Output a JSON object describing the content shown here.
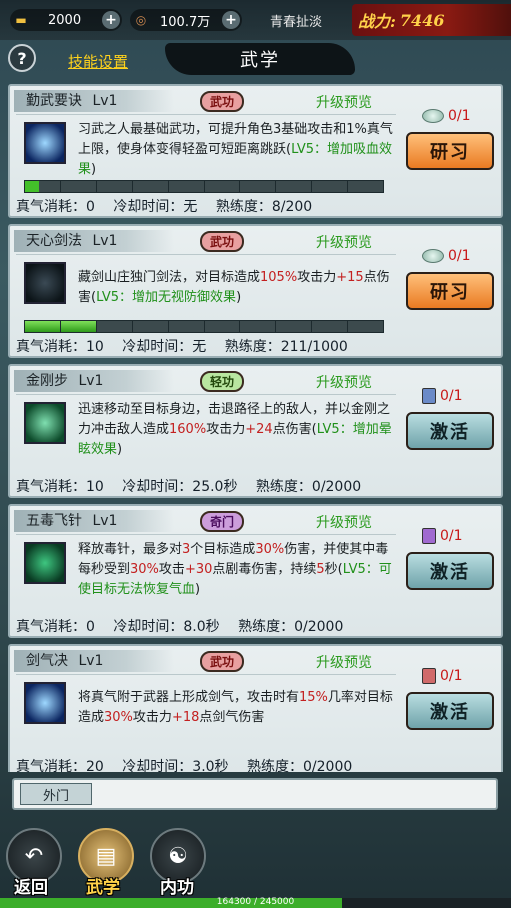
{
  "header": {
    "ingot": "2000",
    "coins": "100.7万",
    "server": "青春扯淡",
    "power_label": "战力:",
    "power_value": "7446",
    "help": "?",
    "skill_settings": "技能设置",
    "title": "武学"
  },
  "skills": [
    {
      "name": "勤武要诀",
      "level": "Lv1",
      "tag": "武功",
      "upgrade": "升级预览",
      "desc_parts": [
        "习武之人最基础武功，可提升角色3基础攻击和1%真气上限，使身体变得轻盈可短距离跳跃(",
        "LV5：增加吸血效果",
        ")"
      ],
      "cost": "0/1",
      "button": "研习",
      "progress": 0.04,
      "stats": {
        "qi": "真气消耗：0",
        "cd": "冷却时间：无",
        "prof": "熟练度：8/200"
      }
    },
    {
      "name": "天心剑法",
      "level": "Lv1",
      "tag": "武功",
      "upgrade": "升级预览",
      "desc_parts": [
        "藏剑山庄独门剑法，对目标造成",
        "105%",
        "攻击力",
        "+15",
        "点伤害(",
        "LV5：增加无视防御效果",
        ")"
      ],
      "cost": "0/1",
      "button": "研习",
      "progress": 0.21,
      "stats": {
        "qi": "真气消耗：10",
        "cd": "冷却时间：无",
        "prof": "熟练度：211/1000"
      }
    },
    {
      "name": "金刚步",
      "level": "Lv1",
      "tag": "轻功",
      "upgrade": "升级预览",
      "desc_parts": [
        "迅速移动至目标身边，击退路径上的敌人，并以金刚之力冲击敌人造成",
        "160%",
        "攻击力",
        "+24",
        "点伤害(",
        "LV5：增加晕眩效果",
        ")"
      ],
      "cost": "0/1",
      "button": "激活",
      "stats": {
        "qi": "真气消耗：10",
        "cd": "冷却时间：25.0秒",
        "prof": "熟练度：0/2000"
      }
    },
    {
      "name": "五毒飞针",
      "level": "Lv1",
      "tag": "奇门",
      "upgrade": "升级预览",
      "desc_parts": [
        "释放毒针，最多对",
        "3",
        "个目标造成",
        "30%",
        "伤害，并使其中毒每秒受到",
        "30%",
        "攻击",
        "+30",
        "点剧毒伤害，持续",
        "5",
        "秒(",
        "LV5：可使目标无法恢复气血",
        ")"
      ],
      "cost": "0/1",
      "button": "激活",
      "stats": {
        "qi": "真气消耗：0",
        "cd": "冷却时间：8.0秒",
        "prof": "熟练度：0/2000"
      }
    },
    {
      "name": "剑气决",
      "level": "Lv1",
      "tag": "武功",
      "upgrade": "升级预览",
      "desc_parts": [
        "将真气附于武器上形成剑气，攻击时有",
        "15%",
        "几率对目标造成",
        "30%",
        "攻击力",
        "+18",
        "点剑气伤害"
      ],
      "cost": "0/1",
      "button": "激活",
      "stats": {
        "qi": "真气消耗：20",
        "cd": "冷却时间：3.0秒",
        "prof": "熟练度：0/2000"
      }
    }
  ],
  "tab": {
    "label": "外门"
  },
  "nav": {
    "back": "返回",
    "martial": "武学",
    "inner": "内功"
  },
  "xp": {
    "text": "164300 / 245000",
    "fill": 0.67
  },
  "colors": {
    "accent": "#ffd21c",
    "upgrade": "#2a9a1e",
    "highlight": "#c32020"
  }
}
